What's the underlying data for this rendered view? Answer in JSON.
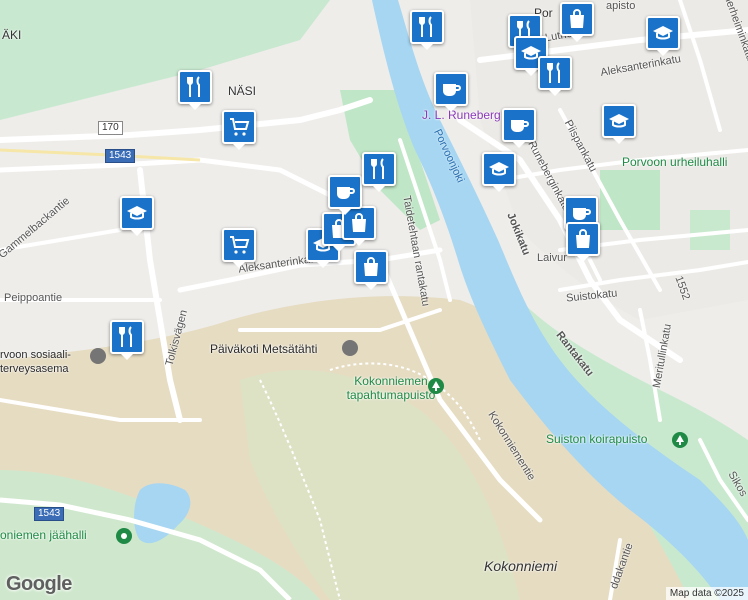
{
  "map": {
    "labels": {
      "nasi": "NÄSI",
      "naki": "ÄKI",
      "aleksanterinkatu_e": "Aleksanterinkatu",
      "aleksanterinkatu_w": "Aleksanterinkatu",
      "porvoonjoki": "Porvoonjoki",
      "taidetehtaan": "Taidetehtaan rantakatu",
      "jokikatu": "Jokikatu",
      "rantakatu": "Rantakatu",
      "runeberginkatu": "Runeberginkatu",
      "piispankatu": "Piispankatu",
      "laivurinkatu": "Laivur",
      "suistokatu": "Suistokatu",
      "lutherinkatu": "Luthe",
      "mannerheiminkatu": "Mannerheiminkatu",
      "urheiluhalli": "Porvoon urheiluhalli",
      "runeberg_transit": "J. L. Runeberg Hotel",
      "paivakoti": "Päiväkoti Metsätähti",
      "tapahtumapuisto": "Kokonniemen tapahtumapuisto",
      "kokonniementie": "Kokonniementie",
      "suiston": "Suiston koirapuisto",
      "jaahalli": "oniemen jäähalli",
      "kokonniemi": "Kokonniemi",
      "tolkisvagen": "Tolkisvägen",
      "gammelbackantie": "Gammelbackantie",
      "peippoantie": "Peippoantie",
      "sosiaali": "rvoon sosiaali- terveysasema",
      "meritullinkatu": "Meritullinkatu",
      "pormestari": "Por",
      "sikosaari": "Sikos",
      "saddakantie": "ddakantie",
      "apisto": "apisto",
      "num_1552": "1552"
    },
    "shields": {
      "r170": "170",
      "r1543a": "1543",
      "r1543b": "1543"
    },
    "colors": {
      "pin": "#1a73c8",
      "water": "#a6d6f2",
      "park": "#bfe6c6",
      "land": "#f1efea",
      "sand": "#e7dcc0"
    },
    "google": "Google",
    "attribution": "Map data ©2025"
  }
}
